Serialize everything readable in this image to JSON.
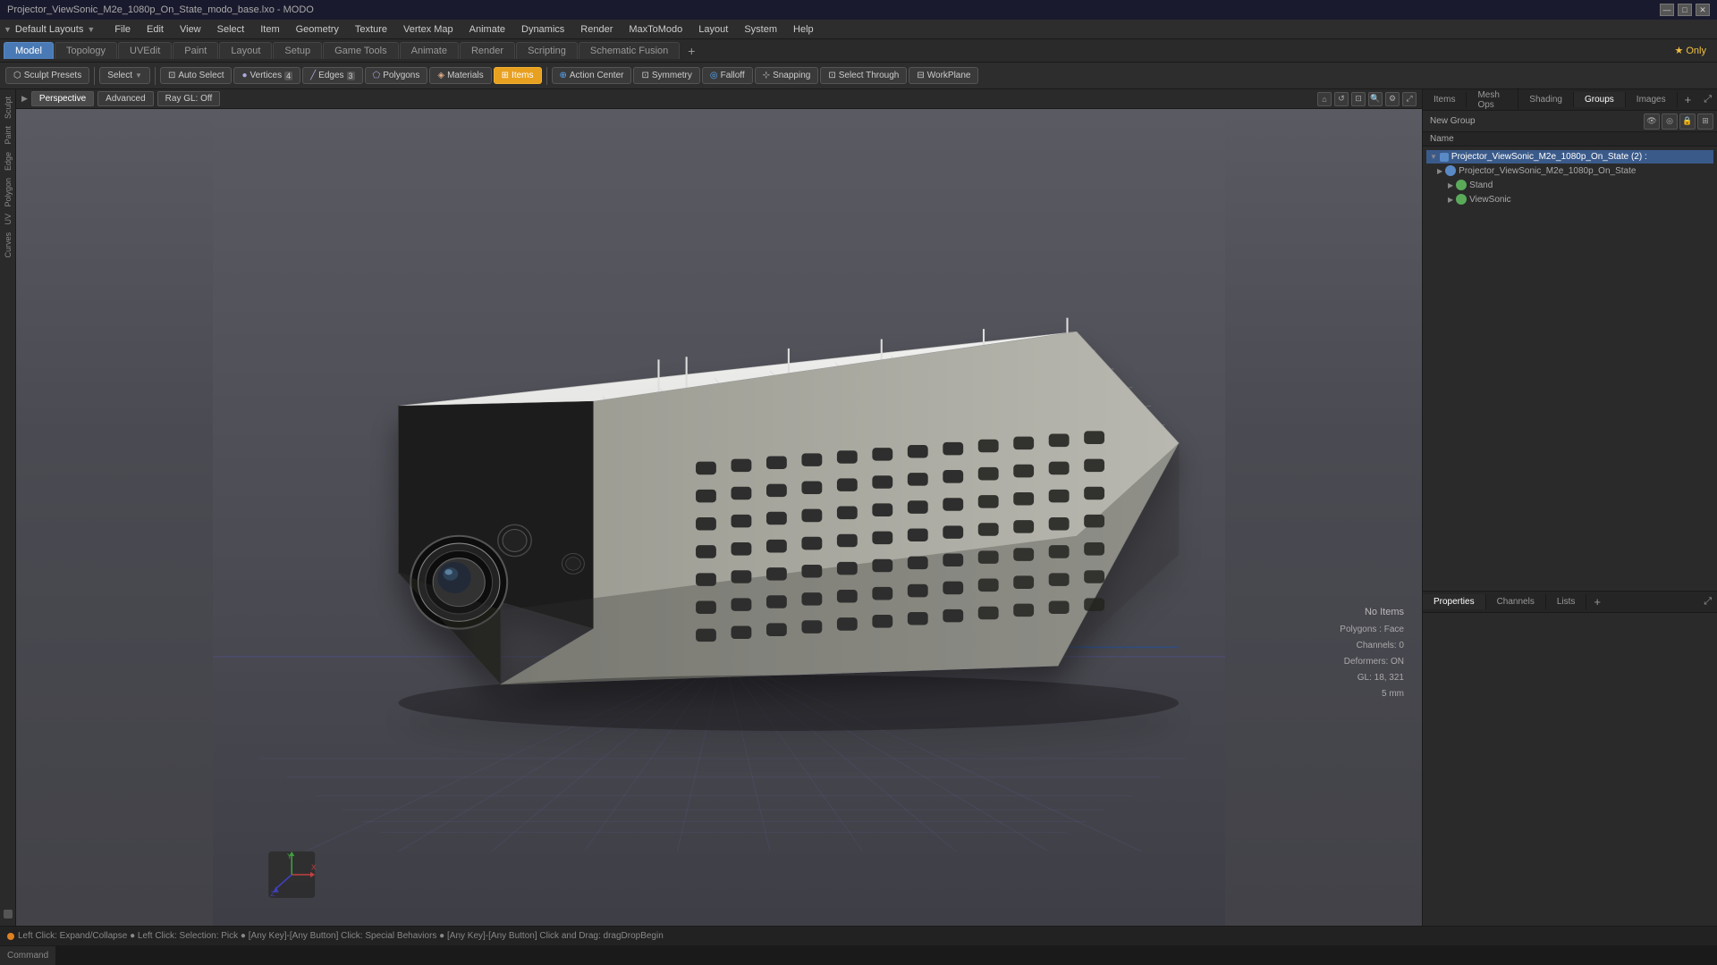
{
  "titlebar": {
    "title": "Projector_ViewSonic_M2e_1080p_On_State_modo_base.lxo - MODO",
    "controls": [
      "—",
      "□",
      "✕"
    ]
  },
  "menubar": {
    "items": [
      "File",
      "Edit",
      "View",
      "Select",
      "Item",
      "Geometry",
      "Texture",
      "Vertex Map",
      "Animate",
      "Dynamics",
      "Render",
      "MaxToModo",
      "Layout",
      "System",
      "Help"
    ]
  },
  "mode_tabs": {
    "items": [
      "Model",
      "Topology",
      "UVEdit",
      "Paint",
      "Layout",
      "Setup",
      "Game Tools",
      "Animate",
      "Render",
      "Scripting",
      "Schematic Fusion"
    ],
    "active": "Model",
    "star_label": "★ Only",
    "plus_label": "+"
  },
  "toolbar": {
    "sculpt_presets_label": "Sculpt Presets",
    "select_label": "Select",
    "auto_select_label": "Auto Select",
    "vertices_label": "Vertices",
    "edges_label": "Edges",
    "polygons_label": "Polygons",
    "materials_label": "Materials",
    "items_label": "Items",
    "action_center_label": "Action Center",
    "symmetry_label": "Symmetry",
    "falloff_label": "Falloff",
    "snapping_label": "Snapping",
    "select_through_label": "Select Through",
    "workplane_label": "WorkPlane"
  },
  "viewport": {
    "perspective_label": "Perspective",
    "advanced_label": "Advanced",
    "ray_gl_label": "Ray GL: Off"
  },
  "right_panel": {
    "tabs": [
      "Items",
      "Mesh Ops",
      "Shading",
      "Groups",
      "Images"
    ],
    "active_tab": "Groups",
    "new_group_label": "New Group",
    "name_label": "Name",
    "scene_root": "Projector_ViewSonic_M2e_1080p_On_State (2) :",
    "items": [
      {
        "label": "Projector_ViewSonic_M2e_1080p_On_State",
        "indent": 1,
        "color": "#5a8ac5"
      },
      {
        "label": "Stand",
        "indent": 2,
        "color": "#5aaa5a"
      },
      {
        "label": "ViewSonic",
        "indent": 2,
        "color": "#5aaa5a"
      }
    ],
    "bottom_tabs": [
      "Properties",
      "Channels",
      "Lists"
    ],
    "bottom_active": "Properties",
    "bottom_plus": "+"
  },
  "status": {
    "no_items": "No Items",
    "polygons_face": "Polygons : Face",
    "channels": "Channels: 0",
    "deformers": "Deformers: ON",
    "gl": "GL: 18, 321",
    "unit": "5 mm"
  },
  "statusbar": {
    "text": "Left Click: Expand/Collapse ● Left Click: Selection: Pick ● [Any Key]-[Any Button] Click: Special Behaviors ● [Any Key]-[Any Button] Click and Drag: dragDropBegin"
  },
  "commandbar": {
    "label": "Command",
    "placeholder": ""
  },
  "layout_label": {
    "default_layouts": "Default Layouts",
    "star": "★"
  },
  "left_sidebar": {
    "labels": [
      "Sculpt",
      "Paint",
      "Edge",
      "Polygon",
      "UV",
      "Curves"
    ]
  }
}
